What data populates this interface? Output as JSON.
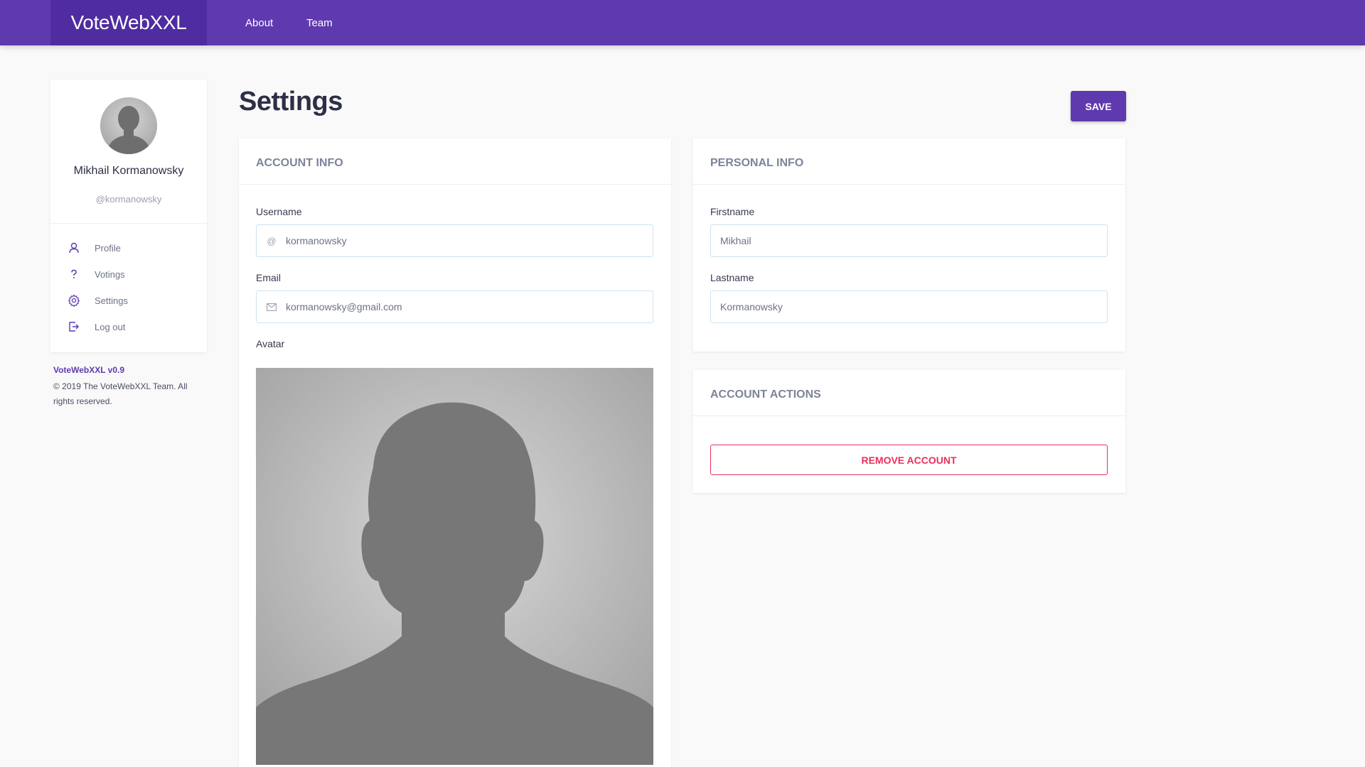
{
  "navbar": {
    "brand": "VoteWebXXL",
    "links": [
      {
        "label": "About"
      },
      {
        "label": "Team"
      }
    ]
  },
  "profile": {
    "name": "Mikhail Kormanowsky",
    "handle": "@kormanowsky"
  },
  "sidebar": {
    "items": [
      {
        "label": "Profile",
        "icon": "user-icon"
      },
      {
        "label": "Votings",
        "icon": "question-icon"
      },
      {
        "label": "Settings",
        "icon": "gear-icon"
      },
      {
        "label": "Log out",
        "icon": "logout-icon"
      }
    ]
  },
  "footer": {
    "version": "VoteWebXXL v0.9",
    "copyright": "© 2019 The VoteWebXXL Team. All rights reserved."
  },
  "page": {
    "title": "Settings",
    "save_label": "SAVE"
  },
  "account_info": {
    "title": "ACCOUNT INFO",
    "username_label": "Username",
    "username_value": "kormanowsky",
    "email_label": "Email",
    "email_value": "kormanowsky@gmail.com",
    "avatar_label": "Avatar"
  },
  "personal_info": {
    "title": "PERSONAL INFO",
    "firstname_label": "Firstname",
    "firstname_value": "Mikhail",
    "lastname_label": "Lastname",
    "lastname_value": "Kormanowsky"
  },
  "account_actions": {
    "title": "ACCOUNT ACTIONS",
    "remove_label": "REMOVE ACCOUNT"
  },
  "colors": {
    "accent": "#5f3aaf",
    "danger": "#e8305b",
    "background": "#f9f9f9"
  }
}
